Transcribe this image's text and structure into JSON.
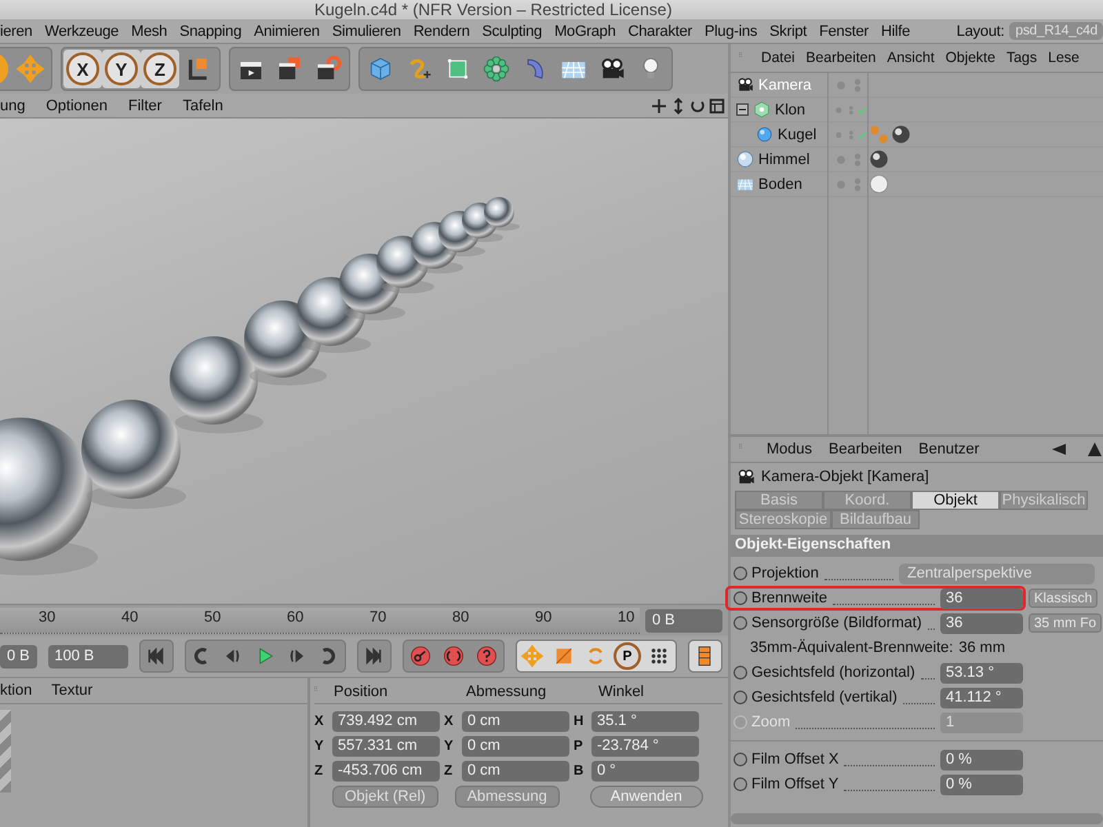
{
  "window": {
    "title": "Kugeln.c4d * (NFR Version – Restricted License)"
  },
  "menu_bar": {
    "items": [
      "ieren",
      "Werkzeuge",
      "Mesh",
      "Snapping",
      "Animieren",
      "Simulieren",
      "Rendern",
      "Sculpting",
      "MoGraph",
      "Charakter",
      "Plug-ins",
      "Skript",
      "Fenster",
      "Hilfe"
    ],
    "layout_label": "Layout:",
    "layout_value": "psd_R14_c4d"
  },
  "toolbar": {
    "axis_buttons": [
      "X",
      "Y",
      "Z"
    ]
  },
  "viewport": {
    "menu": [
      "ung",
      "Optionen",
      "Filter",
      "Tafeln"
    ]
  },
  "timeline": {
    "frame_labels": [
      "30",
      "40",
      "50",
      "60",
      "70",
      "80",
      "90",
      "10"
    ],
    "current_frame": "0 B",
    "start_field": "0 B",
    "end_field": "100 B",
    "param_button": "P"
  },
  "material_manager": {
    "menu": [
      "ktion",
      "Textur"
    ]
  },
  "coordinates": {
    "headers": [
      "Position",
      "Abmessung",
      "Winkel"
    ],
    "rows": [
      {
        "axis": "X",
        "position": "739.492 cm",
        "size_axis": "X",
        "size": "0 cm",
        "angle_axis": "H",
        "angle": "35.1 °"
      },
      {
        "axis": "Y",
        "position": "557.331 cm",
        "size_axis": "Y",
        "size": "0 cm",
        "angle_axis": "P",
        "angle": "-23.784 °"
      },
      {
        "axis": "Z",
        "position": "-453.706 cm",
        "size_axis": "Z",
        "size": "0 cm",
        "angle_axis": "B",
        "angle": "0 °"
      }
    ],
    "mode_dropdown": "Objekt (Rel)",
    "size_dropdown": "Abmessung",
    "apply_button": "Anwenden"
  },
  "object_manager": {
    "menu": [
      "Datei",
      "Bearbeiten",
      "Ansicht",
      "Objekte",
      "Tags",
      "Lese"
    ],
    "objects": [
      {
        "name": "Kamera",
        "kind": "camera",
        "selected": true,
        "enabled": false
      },
      {
        "name": "Klon",
        "kind": "cloner",
        "selected": false,
        "enabled": true,
        "expanded": true,
        "children": [
          {
            "name": "Kugel",
            "kind": "sphere",
            "selected": false,
            "enabled": true,
            "tags": [
              {
                "kind": "dots"
              },
              {
                "kind": "chrome"
              }
            ]
          }
        ]
      },
      {
        "name": "Himmel",
        "kind": "sky",
        "selected": false,
        "enabled": false,
        "tags": [
          {
            "kind": "chrome"
          }
        ]
      },
      {
        "name": "Boden",
        "kind": "floor",
        "selected": false,
        "enabled": false,
        "tags": [
          {
            "kind": "white"
          }
        ]
      }
    ]
  },
  "attribute_manager": {
    "menu": [
      "Modus",
      "Bearbeiten",
      "Benutzer"
    ],
    "title": "Kamera-Objekt [Kamera]",
    "tabs": [
      {
        "label": "Basis",
        "selected": false
      },
      {
        "label": "Koord.",
        "selected": false
      },
      {
        "label": "Objekt",
        "selected": true
      },
      {
        "label": "Physikalisch",
        "selected": false
      },
      {
        "label": "Stereoskopie",
        "selected": false
      },
      {
        "label": "Bildaufbau",
        "selected": false
      }
    ],
    "section": "Objekt-Eigenschaften",
    "rows": [
      {
        "kind": "dropdown",
        "label": "Projektion",
        "value": "Zentralperspektive",
        "disabled": false,
        "highlighted": false
      },
      {
        "kind": "number",
        "label": "Brennweite",
        "value": "36",
        "button": "Klassisch",
        "disabled": false,
        "highlighted": true
      },
      {
        "kind": "number",
        "label": "Sensorgröße (Bildformat)",
        "value": "36",
        "button": "35 mm Fo",
        "disabled": false,
        "highlighted": false
      },
      {
        "kind": "info",
        "label": "35mm-Äquivalent-Brennweite:",
        "value": "36 mm"
      },
      {
        "kind": "number",
        "label": "Gesichtsfeld (horizontal)",
        "value": "53.13 °",
        "disabled": false,
        "highlighted": false
      },
      {
        "kind": "number",
        "label": "Gesichtsfeld (vertikal)",
        "value": "41.112 °",
        "disabled": false,
        "highlighted": false
      },
      {
        "kind": "number",
        "label": "Zoom",
        "value": "1",
        "disabled": true,
        "highlighted": false
      },
      {
        "kind": "separator"
      },
      {
        "kind": "number",
        "label": "Film Offset X",
        "value": "0 %",
        "disabled": false,
        "highlighted": false
      },
      {
        "kind": "number",
        "label": "Film Offset Y",
        "value": "0 %",
        "disabled": false,
        "highlighted": false
      }
    ]
  }
}
